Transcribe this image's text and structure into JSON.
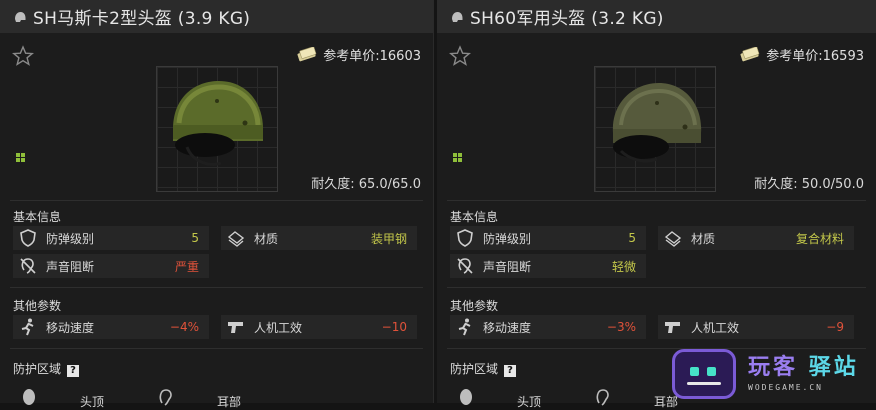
{
  "colors": {
    "value_green": "#c3c74a",
    "value_red": "#e0523a",
    "panel_bg": "#1c1c1c",
    "title_bg": "#2b2b2b"
  },
  "panels": [
    {
      "title": "SH马斯卡2型头盔 (3.9 KG)",
      "price_label": "参考单价:16603",
      "durability": "耐久度: 65.0/65.0",
      "basic_section": "基本信息",
      "armor_class_label": "防弹级别",
      "armor_class_value": "5",
      "material_label": "材质",
      "material_value": "装甲钢",
      "sound_label": "声音阻断",
      "sound_value": "严重",
      "other_section": "其他参数",
      "speed_label": "移动速度",
      "speed_value": "−4%",
      "ergo_label": "人机工效",
      "ergo_value": "−10",
      "protect_section": "防护区域",
      "zone_head": "头顶",
      "zone_ears": "耳部"
    },
    {
      "title": "SH60军用头盔 (3.2 KG)",
      "price_label": "参考单价:16593",
      "durability": "耐久度: 50.0/50.0",
      "basic_section": "基本信息",
      "armor_class_label": "防弹级别",
      "armor_class_value": "5",
      "material_label": "材质",
      "material_value": "复合材料",
      "sound_label": "声音阻断",
      "sound_value": "轻微",
      "other_section": "其他参数",
      "speed_label": "移动速度",
      "speed_value": "−3%",
      "ergo_label": "人机工效",
      "ergo_value": "−9",
      "protect_section": "防护区域",
      "zone_head": "头顶",
      "zone_ears": "耳部"
    }
  ],
  "watermark": {
    "brand_a": "玩客",
    "brand_b": "驿站",
    "site": "WODEGAME.CN"
  }
}
